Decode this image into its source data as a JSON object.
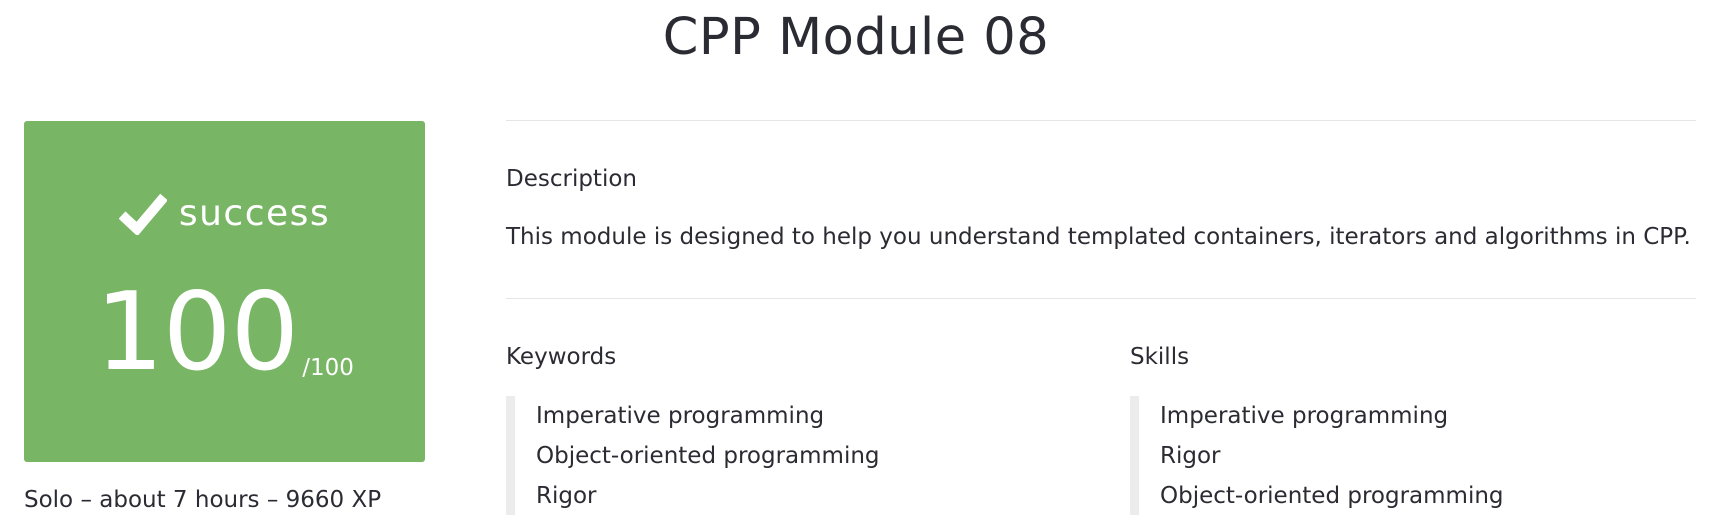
{
  "project": {
    "title": "CPP Module 08"
  },
  "result": {
    "status_label": "success",
    "score": "100",
    "max_score": "/100",
    "status_color": "#78b564"
  },
  "meta": {
    "summary": "Solo – about 7 hours – 9660 XP"
  },
  "description": {
    "heading": "Description",
    "text": "This module is designed to help you understand templated containers, iterators and algorithms in CPP."
  },
  "keywords": {
    "heading": "Keywords",
    "items": [
      "Imperative programming",
      "Object-oriented programming",
      "Rigor"
    ]
  },
  "skills": {
    "heading": "Skills",
    "items": [
      "Imperative programming",
      "Rigor",
      "Object-oriented programming"
    ]
  },
  "icons": {
    "status": "check-icon"
  }
}
